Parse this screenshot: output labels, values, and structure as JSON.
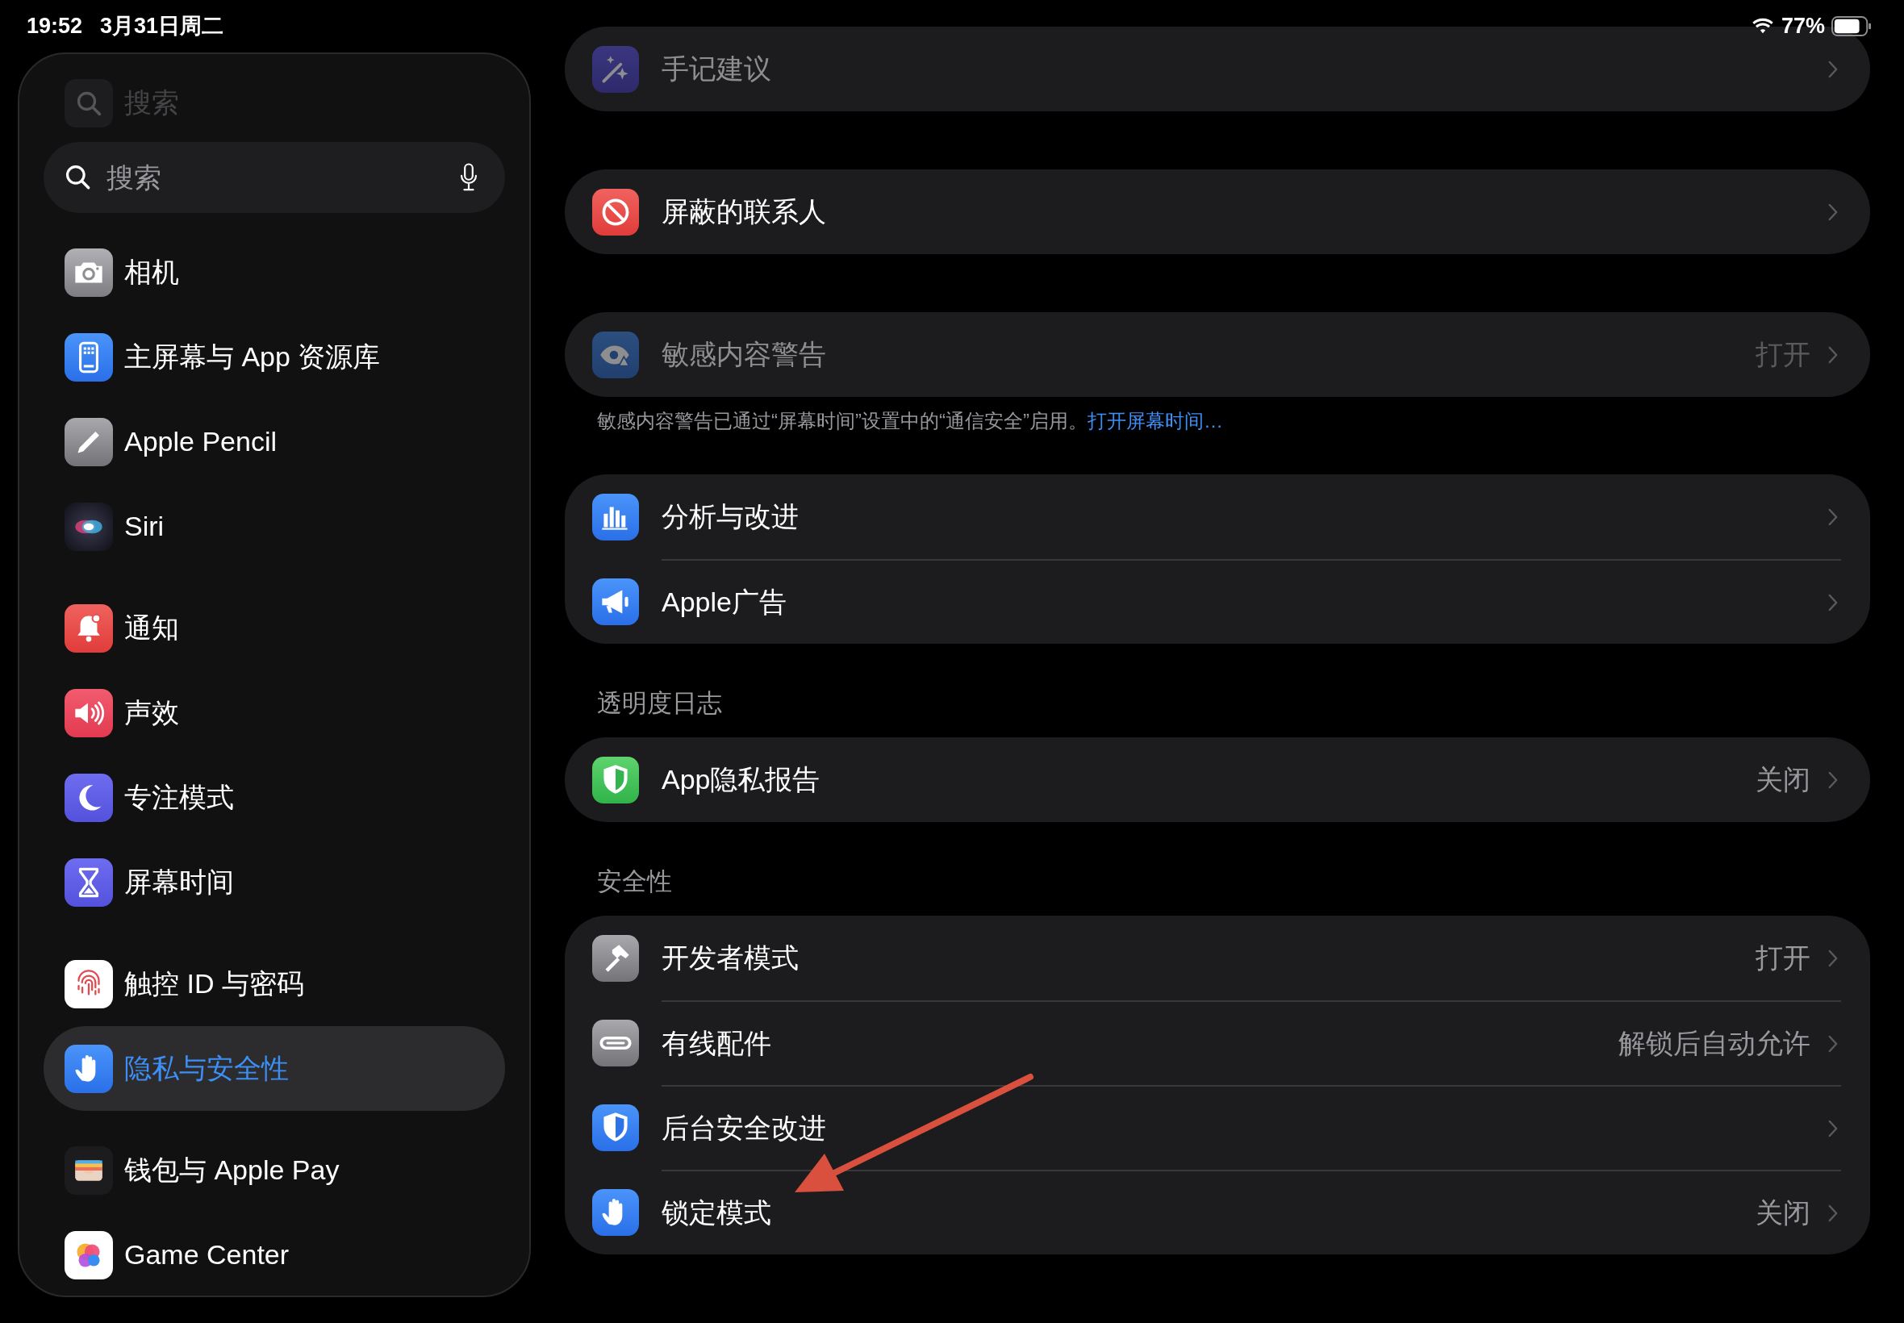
{
  "status_bar": {
    "time": "19:52",
    "date": "3月31日周二",
    "battery": "77%"
  },
  "sidebar": {
    "title": "搜索",
    "search": {
      "placeholder": "搜索"
    },
    "groups": [
      {
        "items": [
          {
            "label": "相机",
            "selected": false
          },
          {
            "label": "主屏幕与 App 资源库",
            "selected": false
          },
          {
            "label": "Apple Pencil",
            "selected": false
          },
          {
            "label": "Siri",
            "selected": false
          }
        ]
      },
      {
        "items": [
          {
            "label": "通知",
            "selected": false
          },
          {
            "label": "声效",
            "selected": false
          },
          {
            "label": "专注模式",
            "selected": false
          },
          {
            "label": "屏幕时间",
            "selected": false
          }
        ]
      },
      {
        "items": [
          {
            "label": "触控 ID 与密码",
            "selected": false
          },
          {
            "label": "隐私与安全性",
            "selected": true
          }
        ]
      },
      {
        "items": [
          {
            "label": "钱包与 Apple Pay",
            "selected": false
          },
          {
            "label": "Game Center",
            "selected": false
          }
        ]
      }
    ]
  },
  "sections": [
    {
      "rows": [
        {
          "label": "手记建议",
          "disabled": true
        }
      ]
    },
    {
      "rows": [
        {
          "label": "屏蔽的联系人",
          "disabled": false
        }
      ]
    },
    {
      "rows": [
        {
          "label": "敏感内容警告",
          "value": "打开",
          "disabled": true
        }
      ],
      "footer": {
        "text": "敏感内容警告已通过“屏幕时间”设置中的“通信安全”启用。",
        "link": "打开屏幕时间…"
      }
    },
    {
      "rows": [
        {
          "label": "分析与改进",
          "disabled": false
        },
        {
          "label": "Apple广告",
          "disabled": false
        }
      ]
    },
    {
      "header": "透明度日志",
      "rows": [
        {
          "label": "App隐私报告",
          "value": "关闭",
          "disabled": false
        }
      ]
    },
    {
      "header": "安全性",
      "rows": [
        {
          "label": "开发者模式",
          "value": "打开",
          "disabled": false
        },
        {
          "label": "有线配件",
          "value": "解锁后自动允许",
          "disabled": false
        },
        {
          "label": "后台安全改进",
          "disabled": false
        },
        {
          "label": "锁定模式",
          "value": "关闭",
          "disabled": false
        }
      ]
    }
  ]
}
